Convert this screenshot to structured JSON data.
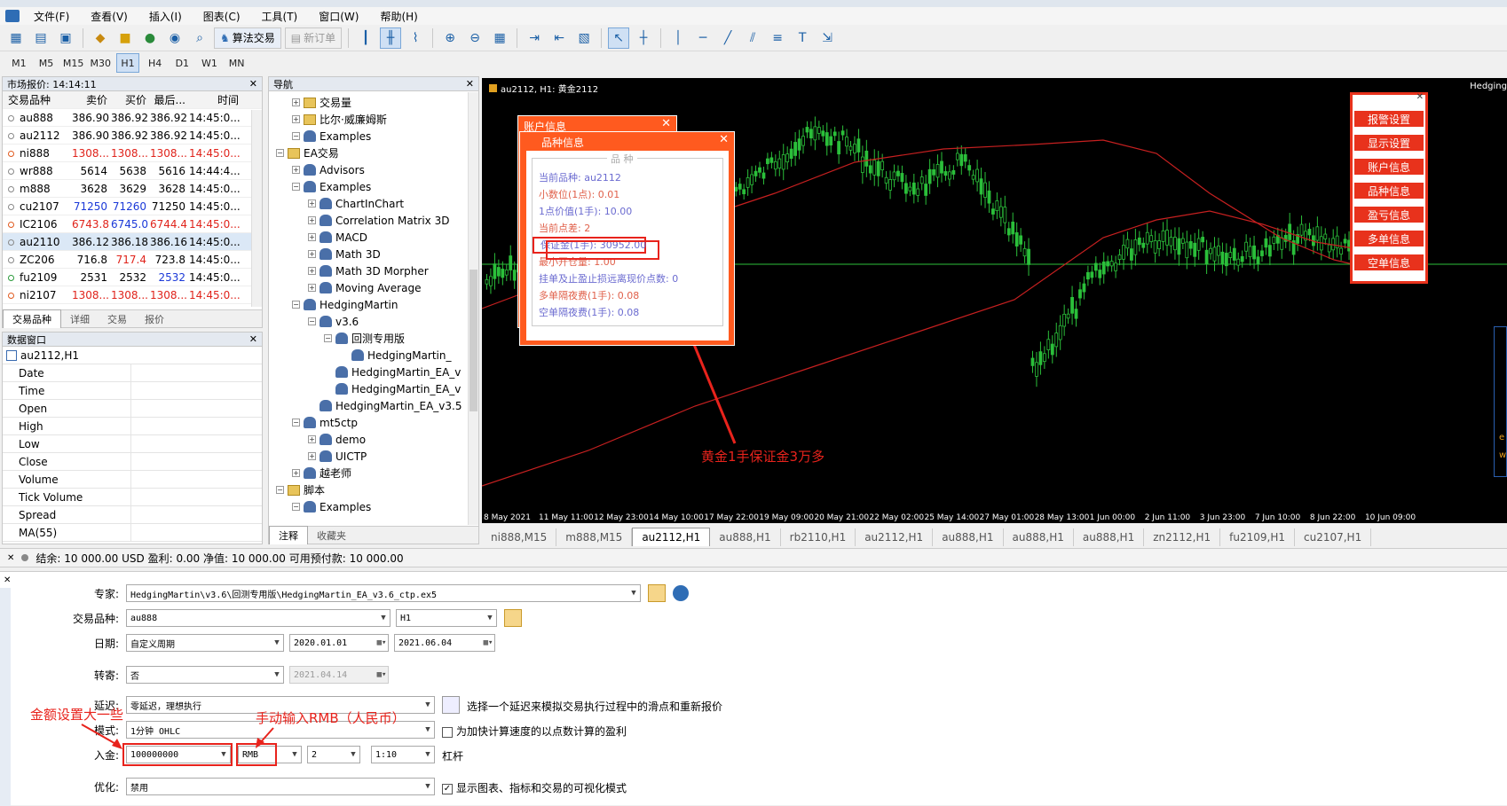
{
  "menu": [
    "文件(F)",
    "查看(V)",
    "插入(I)",
    "图表(C)",
    "工具(T)",
    "窗口(W)",
    "帮助(H)"
  ],
  "toolbar": {
    "algo_label": "算法交易",
    "new_order_label": "新订单"
  },
  "timeframes": [
    "M1",
    "M5",
    "M15",
    "M30",
    "H1",
    "H4",
    "D1",
    "W1",
    "MN"
  ],
  "market_watch": {
    "title": "市场报价: 14:14:11",
    "headers": [
      "交易品种",
      "卖价",
      "买价",
      "最后...",
      "时间"
    ],
    "rows": [
      {
        "sym": "au888",
        "bid": "386.90",
        "ask": "386.92",
        "last": "386.92",
        "time": "14:45:0..."
      },
      {
        "sym": "au2112",
        "bid": "386.90",
        "ask": "386.92",
        "last": "386.92",
        "time": "14:45:0..."
      },
      {
        "sym": "ni888",
        "bid": "1308...",
        "ask": "1308...",
        "last": "1308...",
        "time": "14:45:0..."
      },
      {
        "sym": "wr888",
        "bid": "5614",
        "ask": "5638",
        "last": "5616",
        "time": "14:44:4..."
      },
      {
        "sym": "m888",
        "bid": "3628",
        "ask": "3629",
        "last": "3628",
        "time": "14:45:0..."
      },
      {
        "sym": "cu2107",
        "bid": "71250",
        "ask": "71260",
        "last": "71250",
        "time": "14:45:0..."
      },
      {
        "sym": "IC2106",
        "bid": "6743.8",
        "ask": "6745.0",
        "last": "6744.4",
        "time": "14:45:0..."
      },
      {
        "sym": "au2110",
        "bid": "386.12",
        "ask": "386.18",
        "last": "386.16",
        "time": "14:45:0..."
      },
      {
        "sym": "ZC206",
        "bid": "716.8",
        "ask": "717.4",
        "last": "723.8",
        "time": "14:45:0..."
      },
      {
        "sym": "fu2109",
        "bid": "2531",
        "ask": "2532",
        "last": "2532",
        "time": "14:45:0..."
      },
      {
        "sym": "ni2107",
        "bid": "1308...",
        "ask": "1308...",
        "last": "1308...",
        "time": "14:45:0..."
      }
    ],
    "tabs": [
      "交易品种",
      "详细",
      "交易",
      "报价"
    ]
  },
  "data_window": {
    "title": "数据窗口",
    "symbol": "au2112,H1",
    "rows": [
      "Date",
      "Time",
      "Open",
      "High",
      "Low",
      "Close",
      "Volume",
      "Tick Volume",
      "Spread",
      "MA(55)"
    ]
  },
  "navigator": {
    "title": "导航",
    "items": [
      {
        "label": "交易量",
        "level": 1
      },
      {
        "label": "比尔·威廉姆斯",
        "level": 1
      },
      {
        "label": "Examples",
        "level": 1
      },
      {
        "label": "EA交易",
        "level": 0
      },
      {
        "label": "Advisors",
        "level": 1
      },
      {
        "label": "Examples",
        "level": 1
      },
      {
        "label": "ChartInChart",
        "level": 2
      },
      {
        "label": "Correlation Matrix 3D",
        "level": 2
      },
      {
        "label": "MACD",
        "level": 2
      },
      {
        "label": "Math 3D",
        "level": 2
      },
      {
        "label": "Math 3D Morpher",
        "level": 2
      },
      {
        "label": "Moving Average",
        "level": 2
      },
      {
        "label": "HedgingMartin",
        "level": 1
      },
      {
        "label": "v3.6",
        "level": 2
      },
      {
        "label": "回测专用版",
        "level": 3
      },
      {
        "label": "HedgingMartin_",
        "level": 4
      },
      {
        "label": "HedgingMartin_EA_v",
        "level": 3
      },
      {
        "label": "HedgingMartin_EA_v",
        "level": 3
      },
      {
        "label": "HedgingMartin_EA_v3.5",
        "level": 2
      },
      {
        "label": "mt5ctp",
        "level": 1
      },
      {
        "label": "demo",
        "level": 2
      },
      {
        "label": "UICTP",
        "level": 2
      },
      {
        "label": "越老师",
        "level": 1
      },
      {
        "label": "脚本",
        "level": 0
      },
      {
        "label": "Examples",
        "level": 1
      }
    ],
    "tabs": [
      "注释",
      "收藏夹"
    ]
  },
  "chart": {
    "title": "au2112, H1:  黄金2112",
    "corner_label": "Hedging",
    "x_labels": [
      "8 May 2021",
      "11 May 11:00",
      "12 May 23:00",
      "14 May 10:00",
      "17 May 22:00",
      "19 May 09:00",
      "20 May 21:00",
      "22 May 02:00",
      "25 May 14:00",
      "27 May 01:00",
      "28 May 13:00",
      "1 Jun 00:00",
      "2 Jun 11:00",
      "3 Jun 23:00",
      "7 Jun 10:00",
      "8 Jun 22:00",
      "10 Jun 09:00"
    ],
    "side_labels": [
      "e",
      "w"
    ],
    "account_info_title": "账户信息",
    "symbol_info_title": "品种信息",
    "symbol_info_section": "品  种",
    "info_lines": [
      {
        "text": "当前品种:  au2112",
        "color": "#6b6bd0"
      },
      {
        "text": "小数位(1点):  0.01",
        "color": "#e0604a"
      },
      {
        "text": "1点价值(1手):  10.00",
        "color": "#6b6bd0"
      },
      {
        "text": "当前点差:  2",
        "color": "#e0604a"
      },
      {
        "text": "保证金(1手):  30952.00",
        "color": "#6b6bd0"
      },
      {
        "text": "最小开仓量:  1.00",
        "color": "#e0604a"
      },
      {
        "text": "挂单及止盈止损远离现价点数:  0",
        "color": "#6b6bd0"
      },
      {
        "text": "多单隔夜费(1手):  0.08",
        "color": "#e0604a"
      },
      {
        "text": "空单隔夜费(1手):  0.08",
        "color": "#6b6bd0"
      }
    ],
    "right_buttons": [
      "报警设置",
      "显示设置",
      "账户信息",
      "品种信息",
      "盈亏信息",
      "多单信息",
      "空单信息"
    ],
    "annotation": "黄金1手保证金3万多"
  },
  "chart_tabs": [
    "ni888,M15",
    "m888,M15",
    "au2112,H1",
    "au888,H1",
    "rb2110,H1",
    "au2112,H1",
    "au888,H1",
    "au888,H1",
    "au888,H1",
    "zn2112,H1",
    "fu2109,H1",
    "cu2107,H1"
  ],
  "status": {
    "text": "结余: 10 000.00 USD  盈利: 0.00  净值: 10 000.00  可用预付款: 10 000.00"
  },
  "tester": {
    "expert_label": "专家:",
    "expert_value": "HedgingMartin\\v3.6\\回测专用版\\HedgingMartin_EA_v3.6_ctp.ex5",
    "symbol_label": "交易品种:",
    "symbol_value": "au888",
    "period_value": "H1",
    "date_label": "日期:",
    "date_mode": "自定义周期",
    "date_from": "2020.01.01",
    "date_to": "2021.06.04",
    "forward_label": "转寄:",
    "forward_value": "否",
    "forward_date": "2021.04.14",
    "delay_label": "延迟:",
    "delay_value": "零延迟，理想执行",
    "delay_desc": "选择一个延迟来模拟交易执行过程中的滑点和重新报价",
    "mode_label": "模式:",
    "mode_value": "1分钟 OHLC",
    "mode_desc": "为加快计算速度的以点数计算的盈利",
    "deposit_label": "入金:",
    "deposit_value": "100000000",
    "currency_value": "RMB",
    "digits_value": "2",
    "leverage_value": "1:10",
    "leverage_label": "杠杆",
    "opt_label": "优化:",
    "opt_value": "禁用",
    "visual_desc": "显示图表、指标和交易的可视化模式",
    "ann_deposit": "金额设置大一些",
    "ann_currency": "手动输入RMB（人民币）"
  }
}
